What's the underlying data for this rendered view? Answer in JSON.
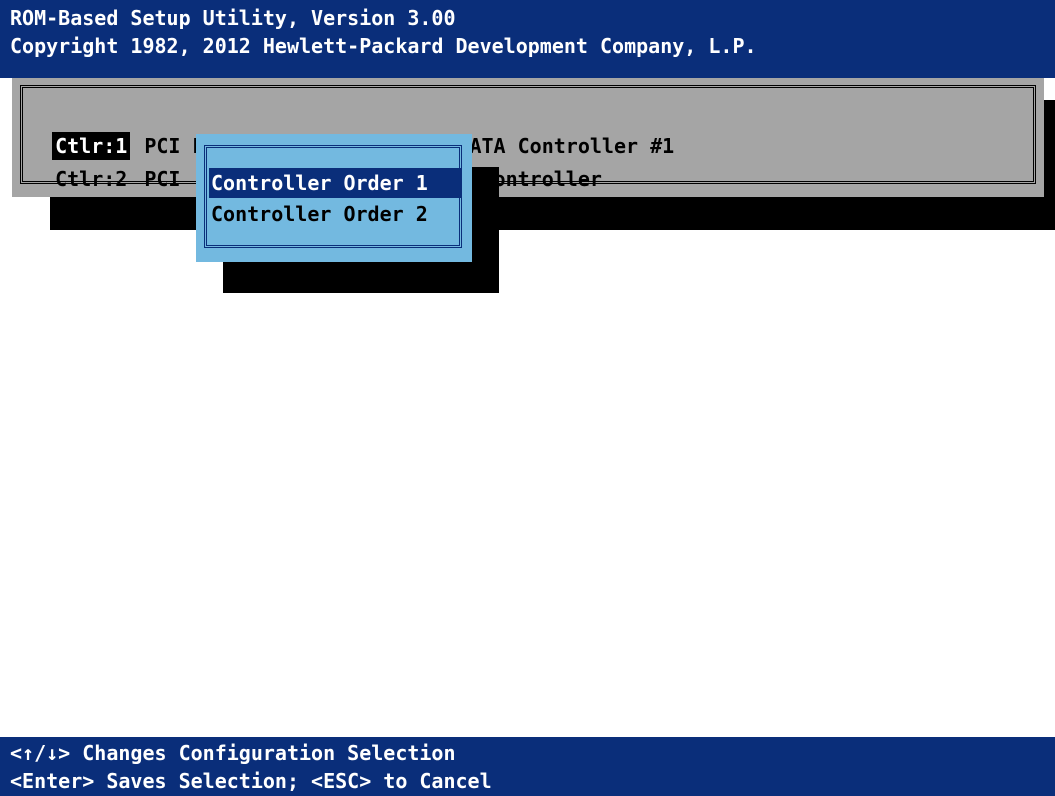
{
  "header": {
    "title": "ROM-Based Setup Utility, Version 3.00",
    "copyright": "Copyright 1982, 2012 Hewlett-Packard Development Company, L.P."
  },
  "controllers": [
    {
      "id": "Ctlr:1",
      "text": "PCI Embedded   AMD SP5100 SATA Controller #1"
    },
    {
      "id": "Ctlr:2",
      "text": "PCI             Array P410i Controller"
    }
  ],
  "popup": {
    "items": [
      "Controller Order 1",
      "Controller Order 2"
    ],
    "selected_index": 0
  },
  "footer": {
    "line1": "<↑/↓> Changes Configuration Selection",
    "line2": "<Enter> Saves Selection; <ESC> to Cancel"
  },
  "colors": {
    "bar_background": "#0a2e7a",
    "list_background": "#a5a5a5",
    "popup_background": "#73b9e0",
    "selection": "#0a2e7a"
  }
}
